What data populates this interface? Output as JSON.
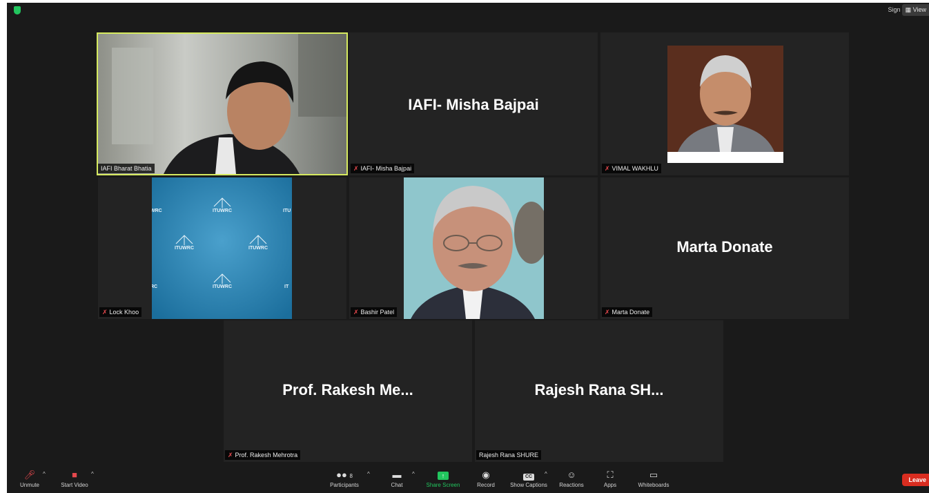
{
  "topbar": {
    "sign_in": "Sign in",
    "view_button": "View"
  },
  "tiles": {
    "t1": {
      "label": "IAFI Bharat Bhatia",
      "muted": false,
      "video": true
    },
    "t2": {
      "label": "IAFI- Misha Bajpai",
      "display_name": "IAFI- Misha Bajpai",
      "muted": true,
      "video": false
    },
    "t3": {
      "label": "VIMAL WAKHLU",
      "muted": true,
      "video": true
    },
    "t4": {
      "label": "Lock Khoo",
      "muted": true,
      "video": true,
      "backdrop_text": "ITUWRC"
    },
    "t5": {
      "label": "Bashir Patel",
      "muted": true,
      "video": true
    },
    "t6": {
      "label": "Marta Donate",
      "display_name": "Marta Donate",
      "muted": true,
      "video": false
    },
    "t7": {
      "label": "Prof. Rakesh Mehrotra",
      "display_name": "Prof. Rakesh Me...",
      "muted": true,
      "video": false
    },
    "t8": {
      "label": "Rajesh Rana SHURE",
      "display_name": "Rajesh Rana SH...",
      "muted": false,
      "video": false
    }
  },
  "toolbar": {
    "unmute": "Unmute",
    "start_video": "Start Video",
    "participants": "Participants",
    "participants_count": "8",
    "chat": "Chat",
    "share_screen": "Share Screen",
    "record": "Record",
    "show_captions": "Show Captions",
    "captions_badge": "CC",
    "reactions": "Reactions",
    "apps": "Apps",
    "whiteboards": "Whiteboards",
    "leave": "Leave"
  },
  "colors": {
    "background": "#1a1a1a",
    "tile": "#232323",
    "active_speaker_border": "#d6ea5f",
    "muted_icon": "#e5484d",
    "share_screen": "#22c55e",
    "leave_button": "#d92d20"
  },
  "icons": [
    "shield-icon",
    "grid-view-icon",
    "mic-muted-icon",
    "video-off-icon",
    "participants-icon",
    "chat-icon",
    "share-screen-icon",
    "record-icon",
    "captions-icon",
    "reactions-icon",
    "apps-icon",
    "whiteboard-icon",
    "caret-up-icon"
  ]
}
